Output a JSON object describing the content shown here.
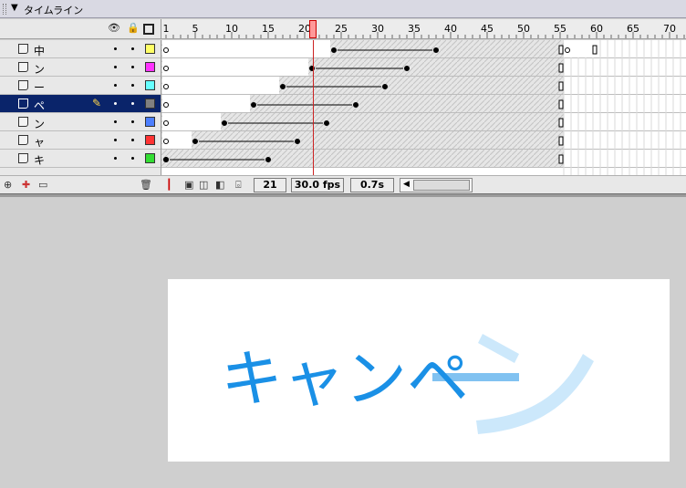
{
  "panel": {
    "title": "タイムライン"
  },
  "header": {
    "eye_icon": "eye-icon",
    "lock_icon": "lock-icon",
    "outline_icon": "outline-icon"
  },
  "layers": [
    {
      "name": "中",
      "color": "#ffff66",
      "selected": false
    },
    {
      "name": "ン",
      "color": "#ff33ff",
      "selected": false
    },
    {
      "name": "ー",
      "color": "#66ffff",
      "selected": false
    },
    {
      "name": "ペ",
      "color": "#808080",
      "selected": true
    },
    {
      "name": "ン",
      "color": "#4d7fff",
      "selected": false
    },
    {
      "name": "ャ",
      "color": "#ff3333",
      "selected": false
    },
    {
      "name": "キ",
      "color": "#33dd33",
      "selected": false
    }
  ],
  "ruler": {
    "ticks": [
      1,
      5,
      10,
      15,
      20,
      25,
      30,
      35,
      40,
      45,
      50,
      55,
      60,
      65,
      70
    ],
    "current_frame_marker": 21
  },
  "status": {
    "frame": "21",
    "fps": "30.0 fps",
    "time": "0.7s"
  },
  "stage": {
    "text_main": "キャンペ",
    "text_ghost": "ン",
    "text_color": "#1a90e6",
    "ghost_color": "#cce8fb"
  }
}
